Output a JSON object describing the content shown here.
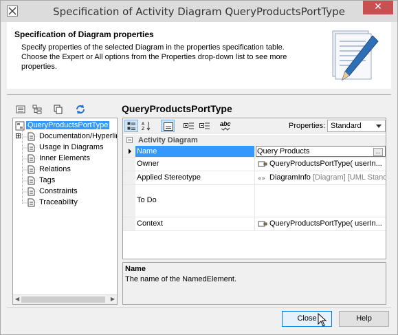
{
  "window": {
    "title": "Specification of Activity Diagram QueryProductsPortType",
    "close_glyph": "✕"
  },
  "banner": {
    "heading": "Specification of Diagram properties",
    "description": "Specify properties of the selected Diagram in the properties specification table. Choose the Expert or All options from the Properties drop-down list to see more properties."
  },
  "tree": {
    "items": [
      {
        "label": "QueryProductsPortType",
        "expander": "",
        "selected": true
      },
      {
        "label": "Documentation/Hyperlinks",
        "expander": "⊞",
        "selected": false
      },
      {
        "label": "Usage in Diagrams",
        "expander": "",
        "selected": false
      },
      {
        "label": "Inner Elements",
        "expander": "",
        "selected": false
      },
      {
        "label": "Relations",
        "expander": "",
        "selected": false
      },
      {
        "label": "Tags",
        "expander": "",
        "selected": false
      },
      {
        "label": "Constraints",
        "expander": "",
        "selected": false
      },
      {
        "label": "Traceability",
        "expander": "",
        "selected": false
      }
    ],
    "scroll_left": "◀",
    "scroll_right": "▶"
  },
  "element_title": "QueryProductsPortType",
  "properties": {
    "label": "Properties:",
    "selected_option": "Standard",
    "group_toggle": "⊟",
    "group_label": "Activity Diagram",
    "rows": [
      {
        "name": "Name",
        "value": "Query Products",
        "extra": "",
        "ellipsis": "..."
      },
      {
        "name": "Owner",
        "value": "QueryProductsPortType( userIn...",
        "extra": "",
        "ellipsis": ""
      },
      {
        "name": "Applied Stereotype",
        "value": "DiagramInfo",
        "extra": " [Diagram] [UML Stand",
        "ellipsis": ""
      },
      {
        "name": "To Do",
        "value": "",
        "extra": "",
        "ellipsis": ""
      },
      {
        "name": "Context",
        "value": "QueryProductsPortType( userIn...",
        "extra": "",
        "ellipsis": ""
      }
    ],
    "toolbar_abc": "abc"
  },
  "description": {
    "name": "Name",
    "text": "The name of the NamedElement."
  },
  "buttons": {
    "close": "Close",
    "help": "Help"
  },
  "colors": {
    "selection": "#3399ff",
    "close_button": "#c75050",
    "default_button_border": "#0078d7"
  }
}
